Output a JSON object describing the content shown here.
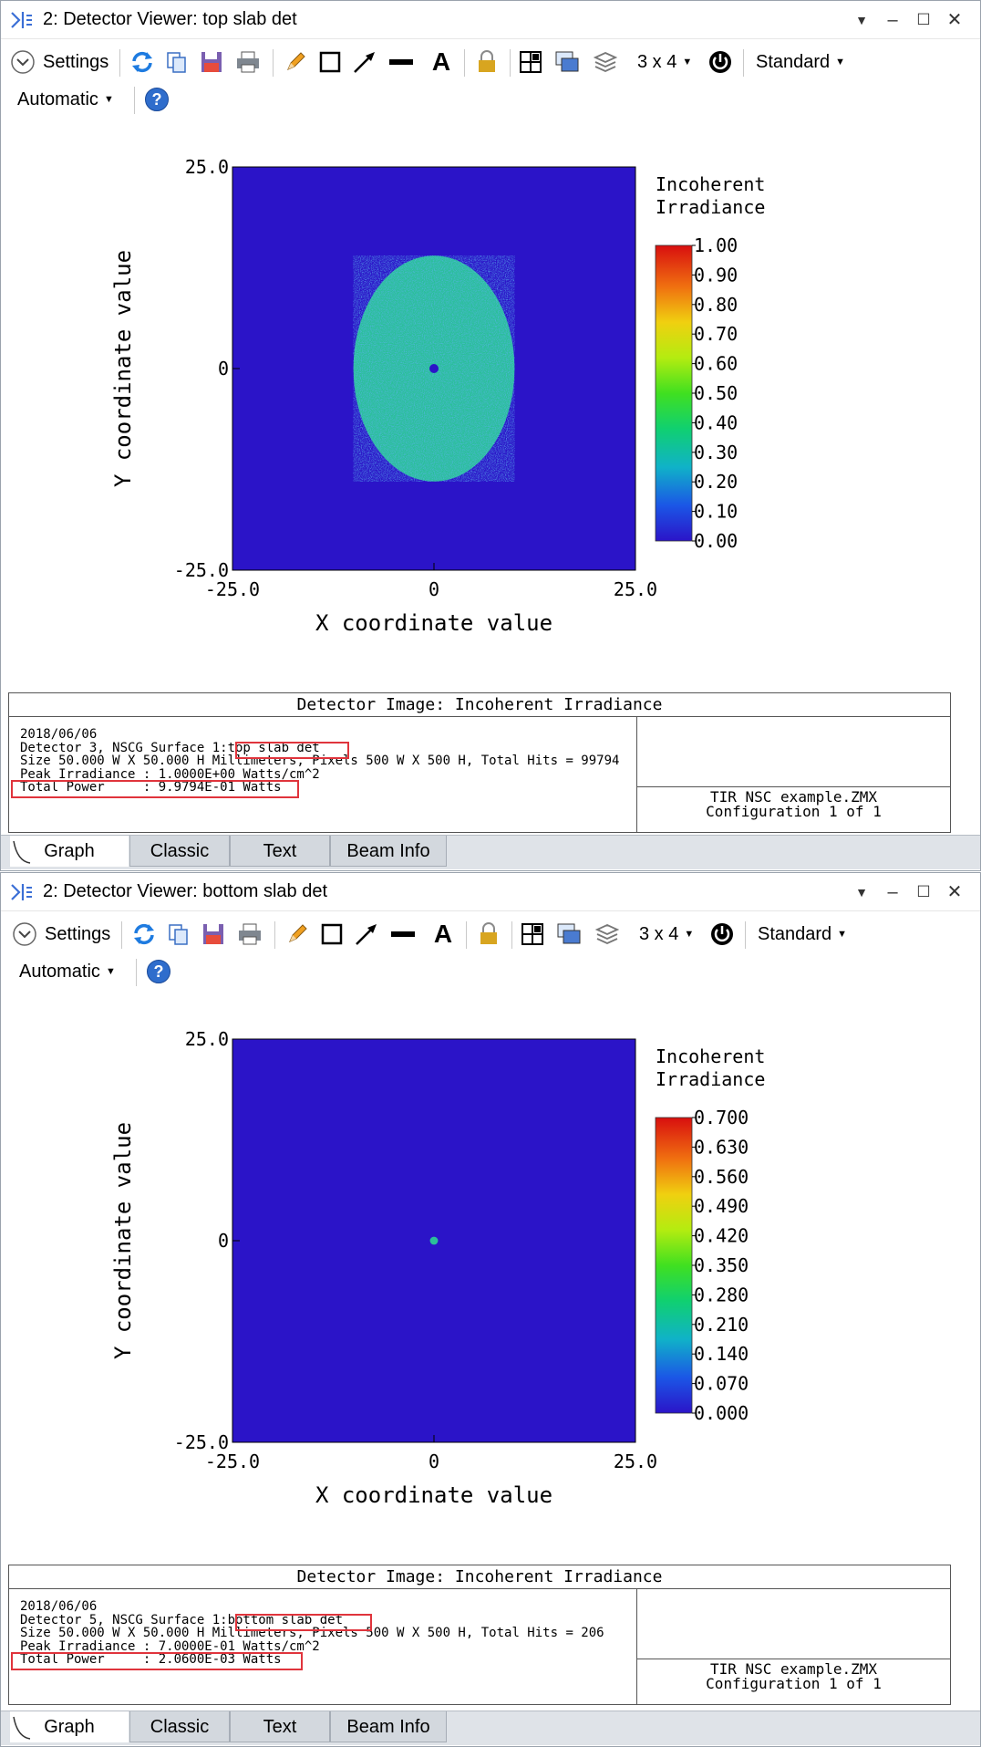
{
  "colors": {
    "background": "#2b14c8",
    "blob": "#2bbf9a",
    "accent_red": "#e0343c",
    "help_blue": "#2f6dcc"
  },
  "toolbar": {
    "settings_label": "Settings",
    "layout_label": "3 x 4",
    "style_label": "Standard",
    "scale_label": "Automatic"
  },
  "tabs": [
    "Graph",
    "Classic",
    "Text",
    "Beam Info"
  ],
  "windows": [
    {
      "title": "2: Detector Viewer: top slab det",
      "chart_data": {
        "type": "heatmap",
        "xlabel": "X coordinate value",
        "ylabel": "Y coordinate value",
        "xlim": [
          -25.0,
          25.0
        ],
        "ylim": [
          -25.0,
          25.0
        ],
        "xticks": [
          "-25.0",
          "0",
          "25.0"
        ],
        "yticks": [
          "25.0",
          "0",
          "-25.0"
        ],
        "colorbar_title": [
          "Incoherent",
          "Irradiance"
        ],
        "colorbar_range": [
          0.0,
          1.0
        ],
        "colorbar_ticks": [
          "1.00",
          "0.90",
          "0.80",
          "0.70",
          "0.60",
          "0.50",
          "0.40",
          "0.30",
          "0.20",
          "0.10",
          "0.00"
        ],
        "spot": {
          "shape": "ellipse",
          "center": [
            0,
            0
          ],
          "half_width": 10,
          "half_height": 14,
          "level": 0.25
        }
      },
      "info": {
        "title": "Detector Image: Incoherent Irradiance",
        "date": "2018/06/06",
        "detector_prefix": "Detector 3, NSCG Surface 1:",
        "detector_name": "top slab det",
        "size_line": "Size 50.000 W X 50.000 H Millimeters, Pixels 500 W X 500 H, Total Hits = 99794",
        "peak_line": "Peak Irradiance : 1.0000E+00 Watts/cm^2",
        "total_power": "Total Power     : 9.9794E-01 Watts",
        "file": "TIR NSC example.ZMX",
        "config": "Configuration 1 of 1"
      }
    },
    {
      "title": "2: Detector Viewer: bottom slab det",
      "chart_data": {
        "type": "heatmap",
        "xlabel": "X coordinate value",
        "ylabel": "Y coordinate value",
        "xlim": [
          -25.0,
          25.0
        ],
        "ylim": [
          -25.0,
          25.0
        ],
        "xticks": [
          "-25.0",
          "0",
          "25.0"
        ],
        "yticks": [
          "25.0",
          "0",
          "-25.0"
        ],
        "colorbar_title": [
          "Incoherent",
          "Irradiance"
        ],
        "colorbar_range": [
          0.0,
          0.7
        ],
        "colorbar_ticks": [
          "0.700",
          "0.630",
          "0.560",
          "0.490",
          "0.420",
          "0.350",
          "0.280",
          "0.210",
          "0.140",
          "0.070",
          "0.000"
        ],
        "spot": {
          "shape": "ellipse",
          "center": [
            0,
            0
          ],
          "half_width": 0.5,
          "half_height": 0.5,
          "level": 0.4
        }
      },
      "info": {
        "title": "Detector Image: Incoherent Irradiance",
        "date": "2018/06/06",
        "detector_prefix": "Detector 5, NSCG Surface 1:",
        "detector_name": "bottom slab det",
        "size_line": "Size 50.000 W X 50.000 H Millimeters, Pixels 500 W X 500 H, Total Hits = 206",
        "peak_line": "Peak Irradiance : 7.0000E-01 Watts/cm^2",
        "total_power": "Total Power     : 2.0600E-03 Watts",
        "file": "TIR NSC example.ZMX",
        "config": "Configuration 1 of 1"
      }
    }
  ]
}
